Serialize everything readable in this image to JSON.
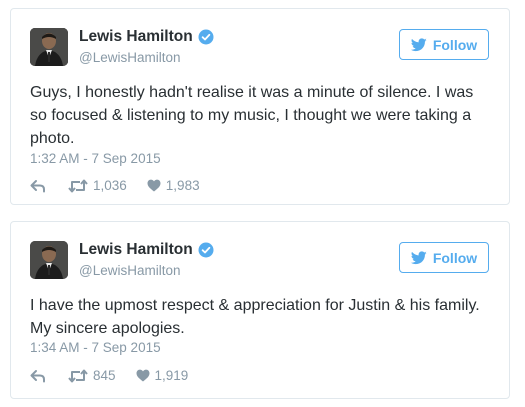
{
  "colors": {
    "accent": "#55acee",
    "verified": "#55acee",
    "text": "#292f33",
    "muted": "#8899a6",
    "border": "#e1e8ed"
  },
  "tweets": [
    {
      "author_name": "Lewis Hamilton",
      "handle": "@LewisHamilton",
      "verified": true,
      "follow_label": "Follow",
      "text": "Guys, I honestly hadn't realise it was a minute of silence. I was so focused & listening to my music, I thought we were taking a photo.",
      "timestamp": "1:32 AM - 7 Sep 2015",
      "retweets": "1,036",
      "likes": "1,983",
      "icons": [
        "avatar",
        "verified-icon",
        "bird-icon",
        "reply-icon",
        "retweet-icon",
        "heart-icon"
      ]
    },
    {
      "author_name": "Lewis Hamilton",
      "handle": "@LewisHamilton",
      "verified": true,
      "follow_label": "Follow",
      "text": "I have the upmost respect & appreciation for Justin & his family. My sincere apologies.",
      "timestamp": "1:34 AM - 7 Sep 2015",
      "retweets": "845",
      "likes": "1,919",
      "icons": [
        "avatar",
        "verified-icon",
        "bird-icon",
        "reply-icon",
        "retweet-icon",
        "heart-icon"
      ]
    }
  ]
}
